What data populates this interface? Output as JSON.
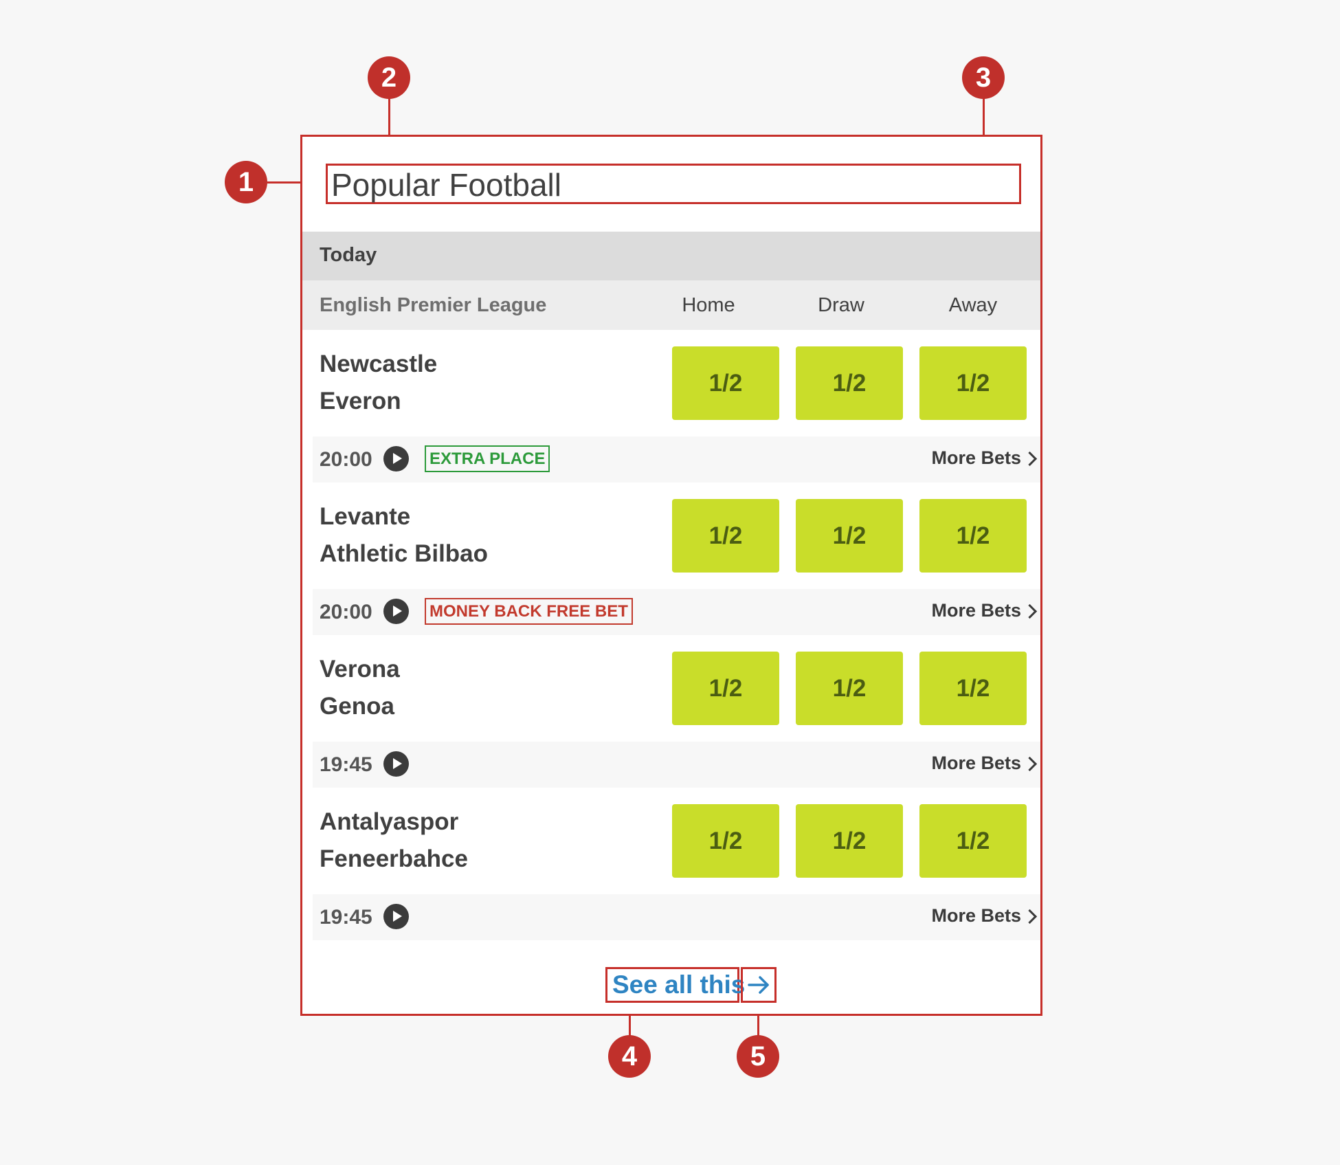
{
  "annotations": [
    "1",
    "2",
    "3",
    "4",
    "5"
  ],
  "widget": {
    "title": "Popular Football",
    "section_label": "Today",
    "league": "English Premier League",
    "columns": [
      "Home",
      "Draw",
      "Away"
    ],
    "matches": [
      {
        "home": "Newcastle",
        "away": "Everon",
        "odds": [
          "1/2",
          "1/2",
          "1/2"
        ],
        "time": "20:00",
        "promo": "EXTRA PLACE",
        "promo_color": "#2c9a3a",
        "more_bets": "More Bets"
      },
      {
        "home": "Levante",
        "away": "Athletic Bilbao",
        "odds": [
          "1/2",
          "1/2",
          "1/2"
        ],
        "time": "20:00",
        "promo": "MONEY BACK FREE BET",
        "promo_color": "#c23a2d",
        "more_bets": "More Bets"
      },
      {
        "home": "Verona",
        "away": "Genoa",
        "odds": [
          "1/2",
          "1/2",
          "1/2"
        ],
        "time": "19:45",
        "promo": "",
        "more_bets": "More Bets"
      },
      {
        "home": "Antalyaspor",
        "away": "Feneerbahce",
        "odds": [
          "1/2",
          "1/2",
          "1/2"
        ],
        "time": "19:45",
        "promo": "",
        "more_bets": "More Bets"
      }
    ],
    "see_all": "See all this",
    "icons": {
      "play": "play-icon",
      "chevron": "chevron-right-icon",
      "arrow": "arrow-right-icon"
    },
    "colors": {
      "odds_bg": "#c9dd2a",
      "odds_text": "#4b5d12",
      "link": "#2e84c2",
      "annotation": "#c0302b"
    }
  }
}
